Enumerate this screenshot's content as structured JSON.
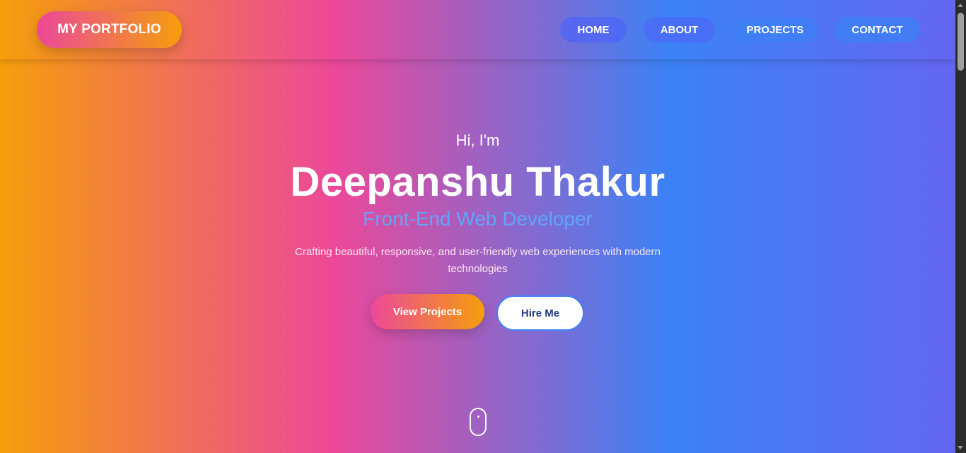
{
  "nav": {
    "logo": "MY PORTFOLIO",
    "items": [
      {
        "label": "HOME"
      },
      {
        "label": "ABOUT"
      },
      {
        "label": "PROJECTS"
      },
      {
        "label": "CONTACT"
      }
    ]
  },
  "hero": {
    "greeting": "Hi, I'm",
    "name": "Deepanshu Thakur",
    "role": "Front-End Web Developer",
    "tagline": "Crafting beautiful, responsive, and user-friendly web experiences with modern technologies",
    "primary_button": "View Projects",
    "secondary_button": "Hire Me"
  },
  "icons": {
    "scroll_indicator": "mouse-scroll-icon"
  },
  "colors": {
    "gradient": [
      "#f59e0b",
      "#ec4899",
      "#3b82f6",
      "#6366f1"
    ],
    "accent_role": "#60a5fa",
    "button_primary": [
      "#ec4899",
      "#f59e0b"
    ],
    "button_secondary_text": "#1e3a8a"
  }
}
